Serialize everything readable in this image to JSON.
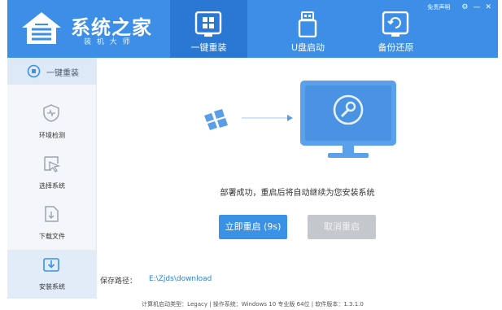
{
  "header": {
    "logo_title": "系统之家",
    "logo_subtitle": "装 机 大 师",
    "tabs": [
      {
        "label": "一键重装",
        "icon": "windows-monitor-icon",
        "active": true
      },
      {
        "label": "U盘启动",
        "icon": "usb-drive-icon",
        "active": false
      },
      {
        "label": "备份还原",
        "icon": "backup-restore-icon",
        "active": false
      }
    ],
    "disclaimer": "免责声明",
    "colors": {
      "header_bg": "#3d8ee6",
      "active_tab_bg": "#2a78d4"
    }
  },
  "sidebar": {
    "top_item": {
      "label": "一键重装",
      "icon": "stop-circle-icon"
    },
    "items": [
      {
        "label": "环境检测",
        "icon": "heart-shield-icon",
        "active": false
      },
      {
        "label": "选择系统",
        "icon": "cursor-select-icon",
        "active": false
      },
      {
        "label": "下载文件",
        "icon": "file-download-icon",
        "active": false
      },
      {
        "label": "安装系统",
        "icon": "install-download-icon",
        "active": true
      }
    ]
  },
  "main": {
    "status_message": "部署成功，重启后将自动继续为您安装系统",
    "restart_button": "立即重启 (9s)",
    "cancel_button": "取消重启",
    "save_path_label": "保存路径：",
    "save_path_value": "E:\\Zjds\\download",
    "colors": {
      "primary": "#3a91e6",
      "disabled": "#c4c7cb",
      "link": "#2b7fd8"
    }
  },
  "footer": {
    "text": "计算机启动类型：Legacy | 操作系统：Windows 10 专业版 64位 | 软件版本：1.3.1.0"
  }
}
